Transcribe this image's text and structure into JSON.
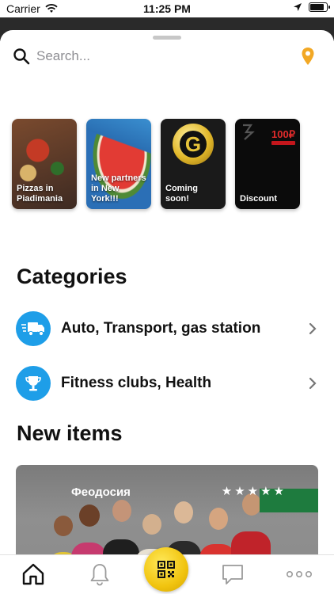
{
  "status_bar": {
    "carrier": "Carrier",
    "time": "11:25 PM",
    "battery_level": 0.85
  },
  "search": {
    "placeholder": "Search..."
  },
  "stories": [
    {
      "label": "Pizzas in Piadimania"
    },
    {
      "label": "New partners in New York!!!"
    },
    {
      "label": "Coming soon!",
      "logo_letter": "G"
    },
    {
      "label": "Discount",
      "price": "100₽"
    }
  ],
  "categories_title": "Categories",
  "categories": [
    {
      "label": "Auto, Transport, gas station",
      "icon": "truck-icon"
    },
    {
      "label": "Fitness clubs, Health",
      "icon": "trophy-icon"
    }
  ],
  "new_items_title": "New items",
  "new_item_card": {
    "city": "Феодосия",
    "rating": 5,
    "stars": "★★★★★"
  },
  "colors": {
    "accent_blue": "#1e9ee8",
    "pin_orange": "#f2a825",
    "qr_yellow": "#f1c40f"
  },
  "tabbar": {
    "items": [
      {
        "icon": "home-icon",
        "active": true
      },
      {
        "icon": "bell-icon"
      },
      {
        "icon": "qr-code-icon"
      },
      {
        "icon": "chat-icon"
      },
      {
        "icon": "more-icon"
      }
    ]
  }
}
